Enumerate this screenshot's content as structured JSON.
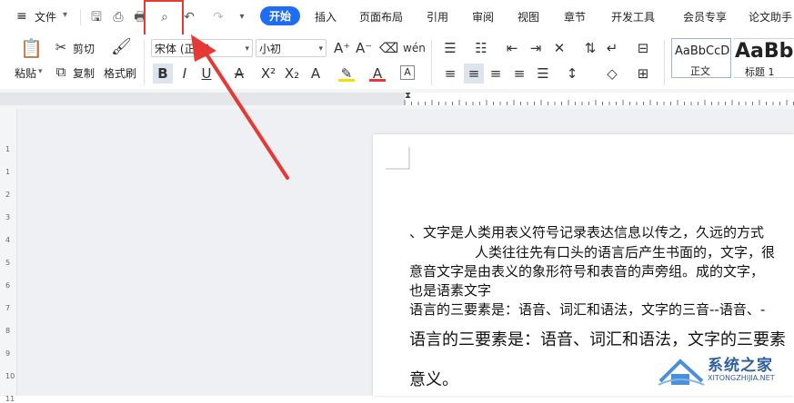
{
  "menu": {
    "file_label": "文件",
    "tabs": [
      "开始",
      "插入",
      "页面布局",
      "引用",
      "审阅",
      "视图",
      "章节",
      "开发工具",
      "会员专享",
      "论文助手"
    ]
  },
  "clipboard": {
    "paste": "粘贴",
    "cut": "剪切",
    "copy": "复制",
    "format_painter": "格式刷"
  },
  "font": {
    "name": "宋体 (正文)",
    "size": "小初"
  },
  "styles": [
    {
      "preview": "AaBbCcD",
      "label": "正文"
    },
    {
      "preview": "AaBb.",
      "label": "标题 1"
    }
  ],
  "vruler_numbers": [
    "1",
    "1",
    "2",
    "3",
    "4",
    "5",
    "6",
    "7",
    "8",
    "9",
    "10",
    "11"
  ],
  "document": {
    "lines": [
      "、文字是人类用表义符号记录表达信息以传之，久远的方式",
      "人类往往先有口头的语言后产生书面的，文字，很",
      "意音文字是由表义的象形符号和表音的声旁组。成的文字，",
      "也是语素文字",
      "语言的三要素是：语音、词汇和语法，文字的三音--语音、-",
      "语言的三要素是：语音、词汇和语法，文字的三要素",
      "意义。"
    ]
  },
  "watermark": {
    "title": "系统之家",
    "url": "XITONGZHIJIA.NET"
  },
  "colors": {
    "accent": "#1d6ef5",
    "highlight_red": "#e53935"
  }
}
